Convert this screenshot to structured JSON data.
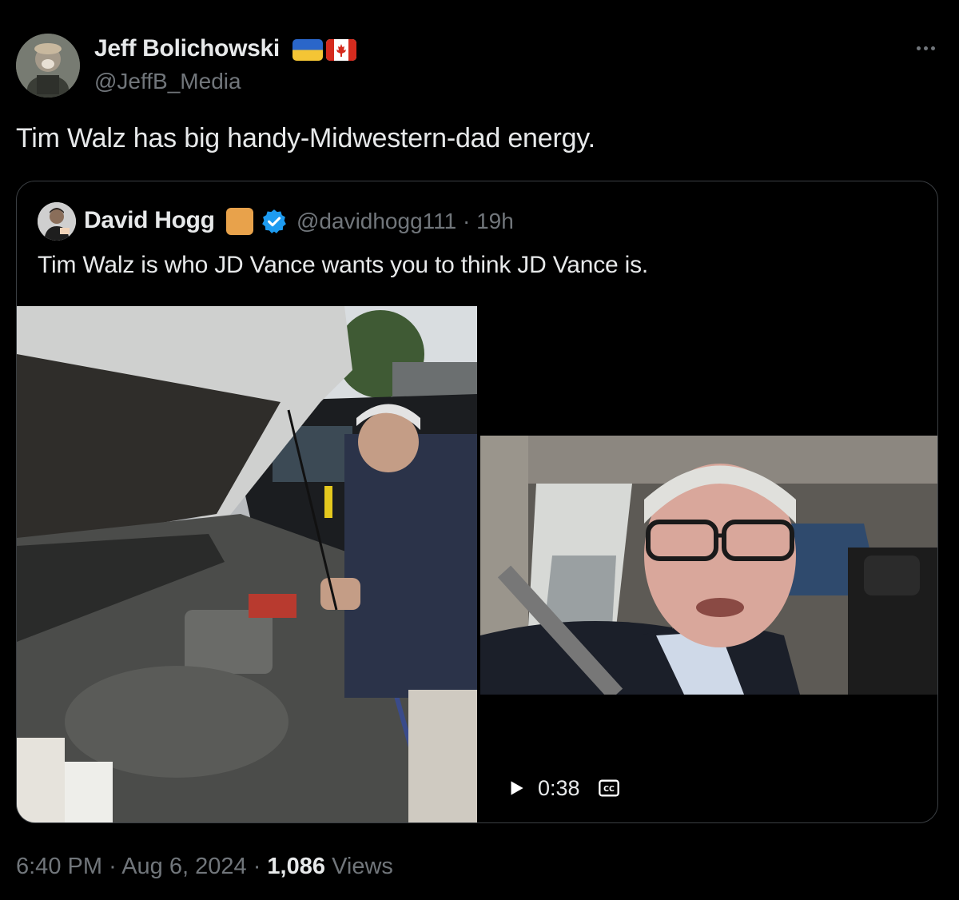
{
  "author": {
    "display_name": "Jeff Bolichowski",
    "handle": "@JeffB_Media",
    "flags": [
      "ukraine-flag-icon",
      "canada-flag-icon"
    ]
  },
  "tweet": {
    "text": "Tim Walz has big handy-Midwestern-dad energy."
  },
  "quoted_tweet": {
    "display_name": "David Hogg",
    "handle_time": "@davidhogg111 · 19h",
    "text": "Tim Walz is who JD Vance wants you to think JD Vance is.",
    "badge_color": "#e8a24b",
    "verified_color": "#1d9bf0",
    "video": {
      "duration": "0:38"
    }
  },
  "footer": {
    "time": "6:40 PM",
    "separator": "·",
    "date": "Aug 6, 2024",
    "views_count": "1,086",
    "views_label": "Views"
  },
  "colors": {
    "background": "#000000",
    "primary_text": "#e7e9ea",
    "secondary_text": "#71767b",
    "border": "#3b3f43"
  }
}
